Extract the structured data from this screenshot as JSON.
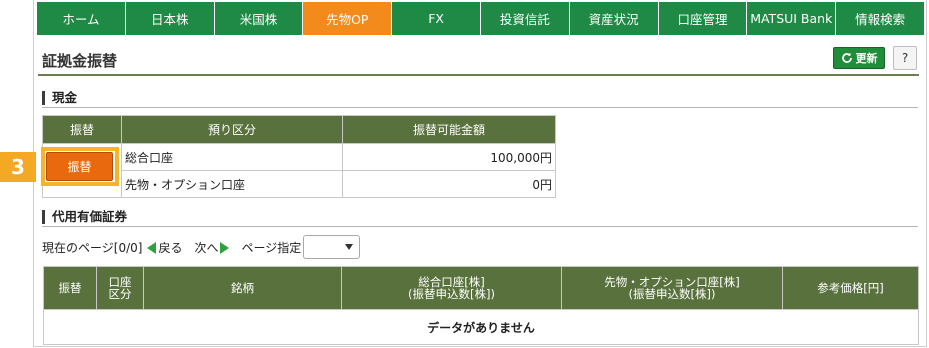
{
  "nav": {
    "items": [
      "ホーム",
      "日本株",
      "米国株",
      "先物OP",
      "FX",
      "投資信託",
      "資産状況",
      "口座管理",
      "MATSUI Bank",
      "情報検索"
    ],
    "active_index": 3
  },
  "page": {
    "title": "証拠金振替",
    "refresh_label": "更新",
    "help_label": "?"
  },
  "cash": {
    "heading": "現金",
    "columns": [
      "振替",
      "預り区分",
      "振替可能金額"
    ],
    "rows": [
      {
        "account": "総合口座",
        "amount": "100,000円"
      },
      {
        "account": "先物・オプション口座",
        "amount": "0円"
      }
    ],
    "transfer_button": "振替"
  },
  "annotation": {
    "step_number": "3"
  },
  "securities": {
    "heading": "代用有価証券",
    "pager": {
      "current": "現在のページ[0/0]",
      "back": "戻る",
      "next": "次へ",
      "page_select_label": "ページ指定",
      "page_select_value": ""
    },
    "columns": [
      {
        "line1": "振替",
        "line2": ""
      },
      {
        "line1": "口座",
        "line2": "区分"
      },
      {
        "line1": "銘柄",
        "line2": ""
      },
      {
        "line1": "総合口座[株]",
        "line2": "(振替申込数[株])"
      },
      {
        "line1": "先物・オプション口座[株]",
        "line2": "(振替申込数[株])"
      },
      {
        "line1": "参考価格[円]",
        "line2": ""
      }
    ],
    "empty_message": "データがありません"
  },
  "colors": {
    "nav_bg": "#1e8a45",
    "nav_active": "#f28b1c",
    "table_header": "#59713d",
    "transfer_button": "#e9690e",
    "highlight": "#f7b42a"
  }
}
